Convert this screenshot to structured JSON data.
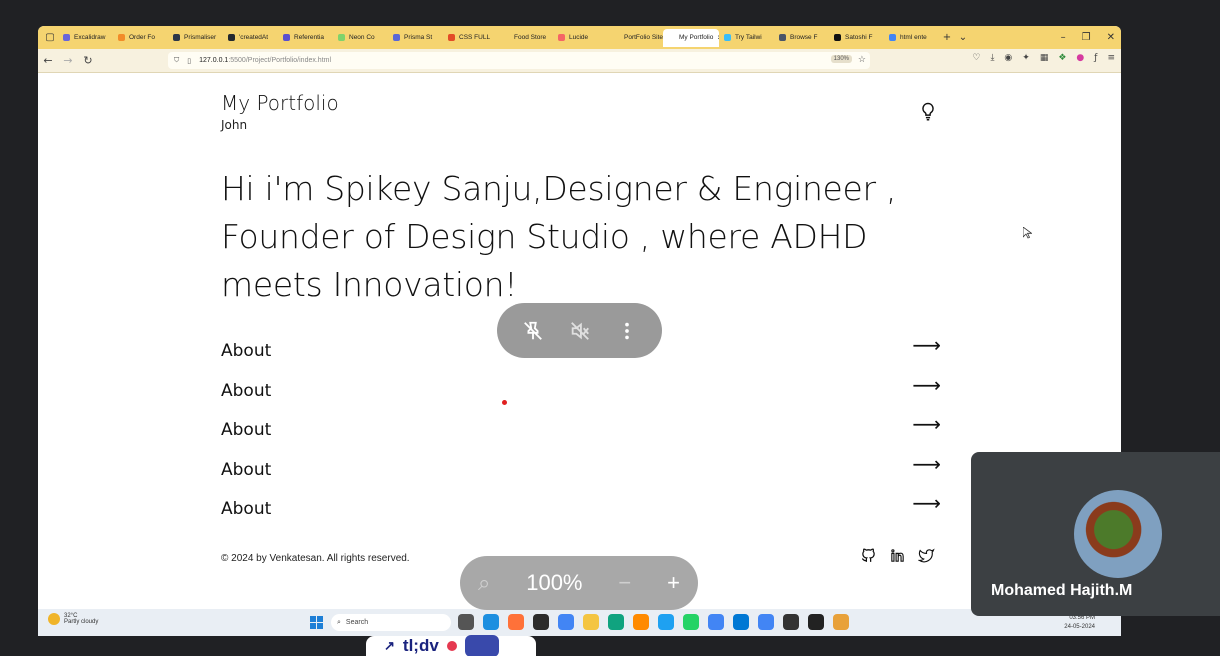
{
  "browser": {
    "tabs": [
      {
        "label": "Excalidraw",
        "color": "#6965db"
      },
      {
        "label": "Order Fo",
        "color": "#f28c28"
      },
      {
        "label": "Prismaliser",
        "color": "#2d3748"
      },
      {
        "label": "'createdAt",
        "color": "#24292e"
      },
      {
        "label": "Referentia",
        "color": "#5a4fcf"
      },
      {
        "label": "Neon Co",
        "color": "#7fd36b"
      },
      {
        "label": "Prisma St",
        "color": "#5a67d8"
      },
      {
        "label": "CSS FULL",
        "color": "#e34c26"
      },
      {
        "label": "Food Store",
        "color": "#f5d470"
      },
      {
        "label": "Lucide",
        "color": "#f56565"
      },
      {
        "label": "PortFolio Site",
        "color": "#f5d470"
      },
      {
        "label": "My Portfolio",
        "color": "#ffffff",
        "active": true
      },
      {
        "label": "Try Tailwi",
        "color": "#38bdf8"
      },
      {
        "label": "Browse F",
        "color": "#4a5568"
      },
      {
        "label": "Satoshi F",
        "color": "#111111"
      },
      {
        "label": "html ente",
        "color": "#4285f4"
      }
    ],
    "url_main": "127.0.0.1",
    "url_rest": ":5500/Project/Portfolio/index.html",
    "zoom_tag": "130%"
  },
  "page": {
    "brand": "My Portfolio",
    "brand_sub": "John",
    "hero": "Hi i'm Spikey Sanju,Designer & Engineer , Founder of Design Studio , where ADHD meets Innovation!",
    "links": [
      {
        "label": "About",
        "arrow": "⟶"
      },
      {
        "label": "About",
        "arrow": "⟶"
      },
      {
        "label": "About",
        "arrow": "⟶"
      },
      {
        "label": "About",
        "arrow": "⟶"
      },
      {
        "label": "About",
        "arrow": "⟶"
      }
    ],
    "footer": "© 2024 by Venkatesan. All rights reserved."
  },
  "taskbar": {
    "temp": "32°C",
    "weather": "Partly cloudy",
    "search": "Search",
    "time": "03:56 PM",
    "date": "24-05-2024"
  },
  "overlay": {
    "zoom_value": "100%",
    "zoom_minus": "−",
    "zoom_plus": "+"
  },
  "video": {
    "participant": "Mohamed Hajith.M"
  },
  "bottom_app": {
    "label": "tl;dv"
  }
}
